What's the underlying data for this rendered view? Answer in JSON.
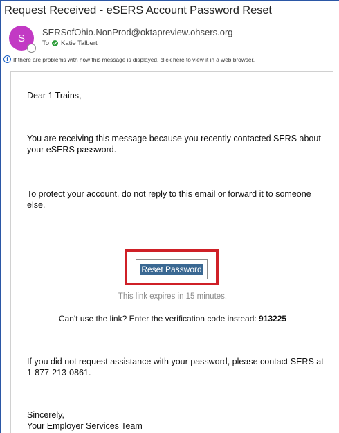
{
  "email": {
    "subject": "Request Received - eSERS Account Password Reset",
    "avatar_initial": "S",
    "sender": "SERSofOhio.NonProd@oktapreview.ohsers.org",
    "to_label": "To",
    "recipient": "Katie Talbert",
    "info_banner": "If there are problems with how this message is displayed, click here to view it in a web browser."
  },
  "body": {
    "greeting": "Dear 1 Trains,",
    "receiving": "You are receiving this message because you recently contacted SERS about your eSERS password.",
    "protect": "To protect your account, do not reply to this email or forward it to someone else.",
    "reset_button": "Reset Password",
    "expires": "This link expires in 15 minutes.",
    "verify_prefix": "Can't use the link? Enter the verification code instead: ",
    "verify_code": "913225",
    "contact": "If you did not request assistance with your password, please contact SERS at 1-877-213-0861.",
    "sincerely": "Sincerely,",
    "team": "Your Employer Services Team"
  },
  "colors": {
    "avatar": "#c239c4",
    "highlight": "#cf2027",
    "button_text_bg": "#3a6892",
    "window_accent": "#2b57a6"
  },
  "icons": [
    "info-icon",
    "check-icon"
  ]
}
